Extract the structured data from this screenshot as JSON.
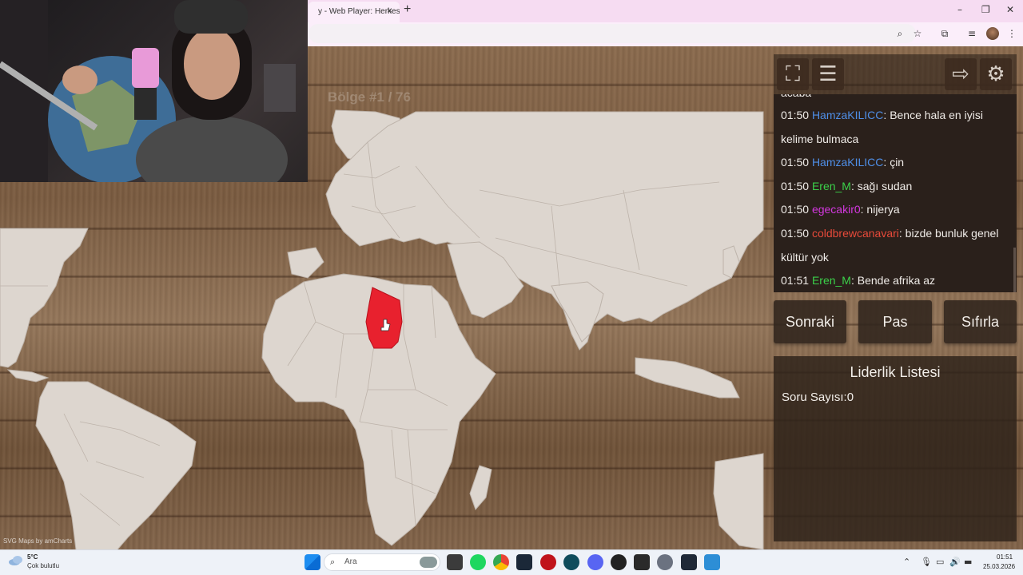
{
  "browser": {
    "tab_title": "y - Web Player: Herkes iç",
    "tab_close": "×",
    "new_tab": "+",
    "minimize": "–",
    "restore": "❐",
    "close": "✕"
  },
  "game": {
    "region_counter": "Bölge #1 / 76",
    "map_credit": "SVG Maps by amCharts",
    "highlight_color": "#e8212e",
    "land_color": "#ddd6cf"
  },
  "chat": {
    "cut_line": "acaba",
    "messages": [
      {
        "time": "01:50",
        "user": "HamzaKILICC",
        "color": "#4f8fe8",
        "text": "Bence hala en iyisi kelime bulmaca"
      },
      {
        "time": "01:50",
        "user": "HamzaKILICC",
        "color": "#4f8fe8",
        "text": "çin"
      },
      {
        "time": "01:50",
        "user": "Eren_M",
        "color": "#3bd14a",
        "text": "sağı sudan"
      },
      {
        "time": "01:50",
        "user": "egecakir0",
        "color": "#d438e0",
        "text": "nijerya"
      },
      {
        "time": "01:50",
        "user": "coldbrewcanavari",
        "color": "#e84a3a",
        "text": "bizde bunluk genel kültür yok"
      },
      {
        "time": "01:51",
        "user": "Eren_M",
        "color": "#3bd14a",
        "text": "Bende afrika az"
      }
    ]
  },
  "actions": {
    "next": "Sonraki",
    "pass": "Pas",
    "reset": "Sıfırla"
  },
  "leaderboard": {
    "title": "Liderlik Listesi",
    "question_count": "Soru Sayısı:0"
  },
  "taskbar": {
    "temperature": "5°C",
    "weather": "Çok bulutlu",
    "search_placeholder": "Ara",
    "time": "01:51",
    "date": "25.03.2026"
  }
}
